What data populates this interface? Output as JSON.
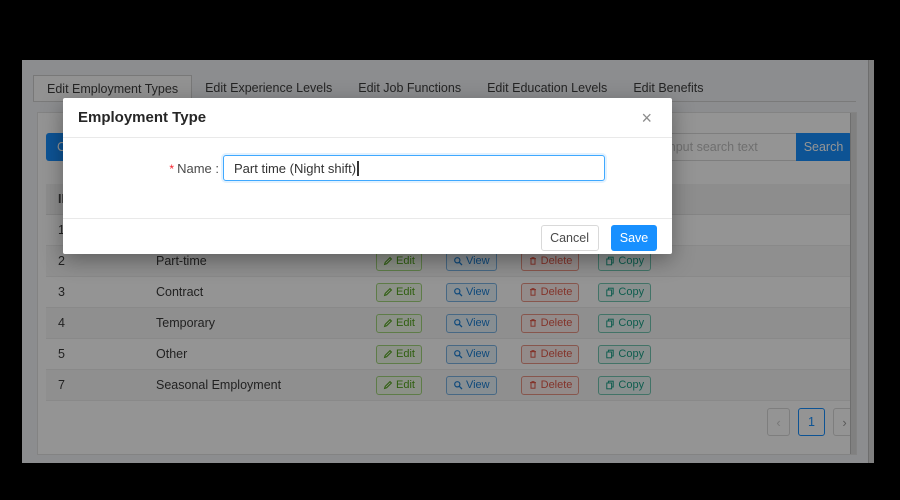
{
  "tabs": {
    "items": [
      {
        "label": "Edit Employment Types",
        "active": true
      },
      {
        "label": "Edit Experience Levels",
        "active": false
      },
      {
        "label": "Edit Job Functions",
        "active": false
      },
      {
        "label": "Edit Education Levels",
        "active": false
      },
      {
        "label": "Edit Benefits",
        "active": false
      }
    ]
  },
  "toolbar": {
    "create_button_visible_glyph": "C",
    "search_placeholder": "input search text",
    "search_button_label": "Search"
  },
  "table": {
    "headers": [
      "ID",
      "",
      ""
    ],
    "rows": [
      {
        "id": "1",
        "name": ""
      },
      {
        "id": "2",
        "name": "Part-time"
      },
      {
        "id": "3",
        "name": "Contract"
      },
      {
        "id": "4",
        "name": "Temporary"
      },
      {
        "id": "5",
        "name": "Other"
      },
      {
        "id": "7",
        "name": "Seasonal Employment"
      }
    ],
    "actions": [
      {
        "name": "edit",
        "label": "Edit",
        "icon": "pencil-icon"
      },
      {
        "name": "view",
        "label": "View",
        "icon": "magnifier-icon"
      },
      {
        "name": "delete",
        "label": "Delete",
        "icon": "trash-icon"
      },
      {
        "name": "copy",
        "label": "Copy",
        "icon": "copy-icon"
      }
    ]
  },
  "pagination": {
    "prev": "‹",
    "page": "1",
    "next": "›"
  },
  "modal": {
    "title": "Employment Type",
    "close_glyph": "×",
    "required_mark": "*",
    "name_label": "Name :",
    "name_value": "Part time (Night shift)",
    "cancel_label": "Cancel",
    "save_label": "Save"
  },
  "colors": {
    "accent_blue": "#1890ff",
    "edit_green": "#52a41c",
    "view_blue": "#1a7fd4",
    "delete_red": "#e25949",
    "copy_teal": "#1ba188",
    "required_red": "#f5222d"
  }
}
